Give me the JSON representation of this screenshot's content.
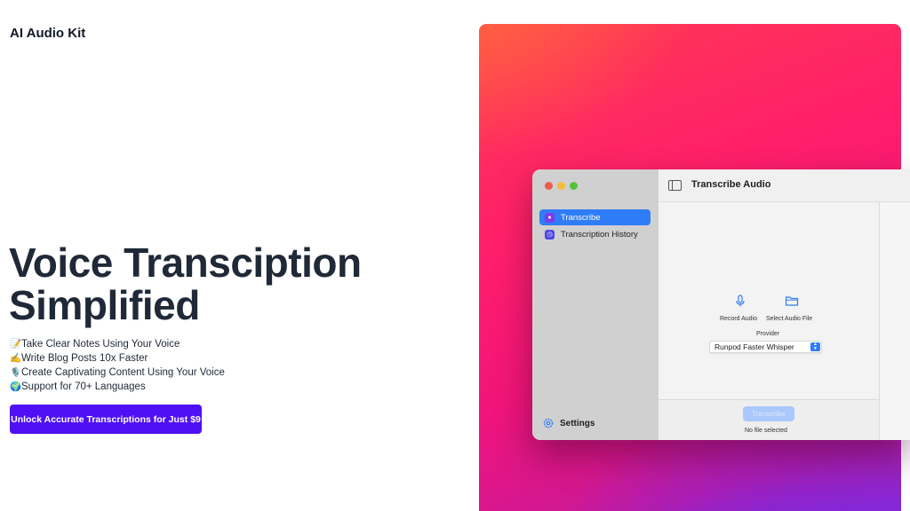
{
  "header": {
    "brand": "AI Audio Kit"
  },
  "hero": {
    "title_line1": "Voice Transciption",
    "title_line2": "Simplified",
    "features": [
      {
        "emoji": "📝",
        "text": "Take Clear Notes Using Your Voice"
      },
      {
        "emoji": "✍️",
        "text": "Write Blog Posts 10x Faster"
      },
      {
        "emoji": "🎙️",
        "text": "Create Captivating Content Using Your Voice"
      },
      {
        "emoji": "🌍",
        "text": "Support for 70+ Languages"
      }
    ],
    "cta_label": "Unlock Accurate Transcriptions for Just $9"
  },
  "app": {
    "sidebar": {
      "items": [
        {
          "label": "Transcribe",
          "icon": "mic-icon",
          "active": true
        },
        {
          "label": "Transcription History",
          "icon": "history-icon",
          "active": false
        }
      ],
      "settings_label": "Settings"
    },
    "main": {
      "title": "Transcribe Audio",
      "record_label": "Record Audio",
      "select_file_label": "Select Audio File",
      "provider_label": "Provider",
      "provider_value": "Runpod Faster Whisper",
      "transcribe_button": "Transcribe",
      "status_text": "No file selected"
    },
    "colors": {
      "accent": "#2f7df6",
      "cta": "#4f10f5"
    }
  }
}
